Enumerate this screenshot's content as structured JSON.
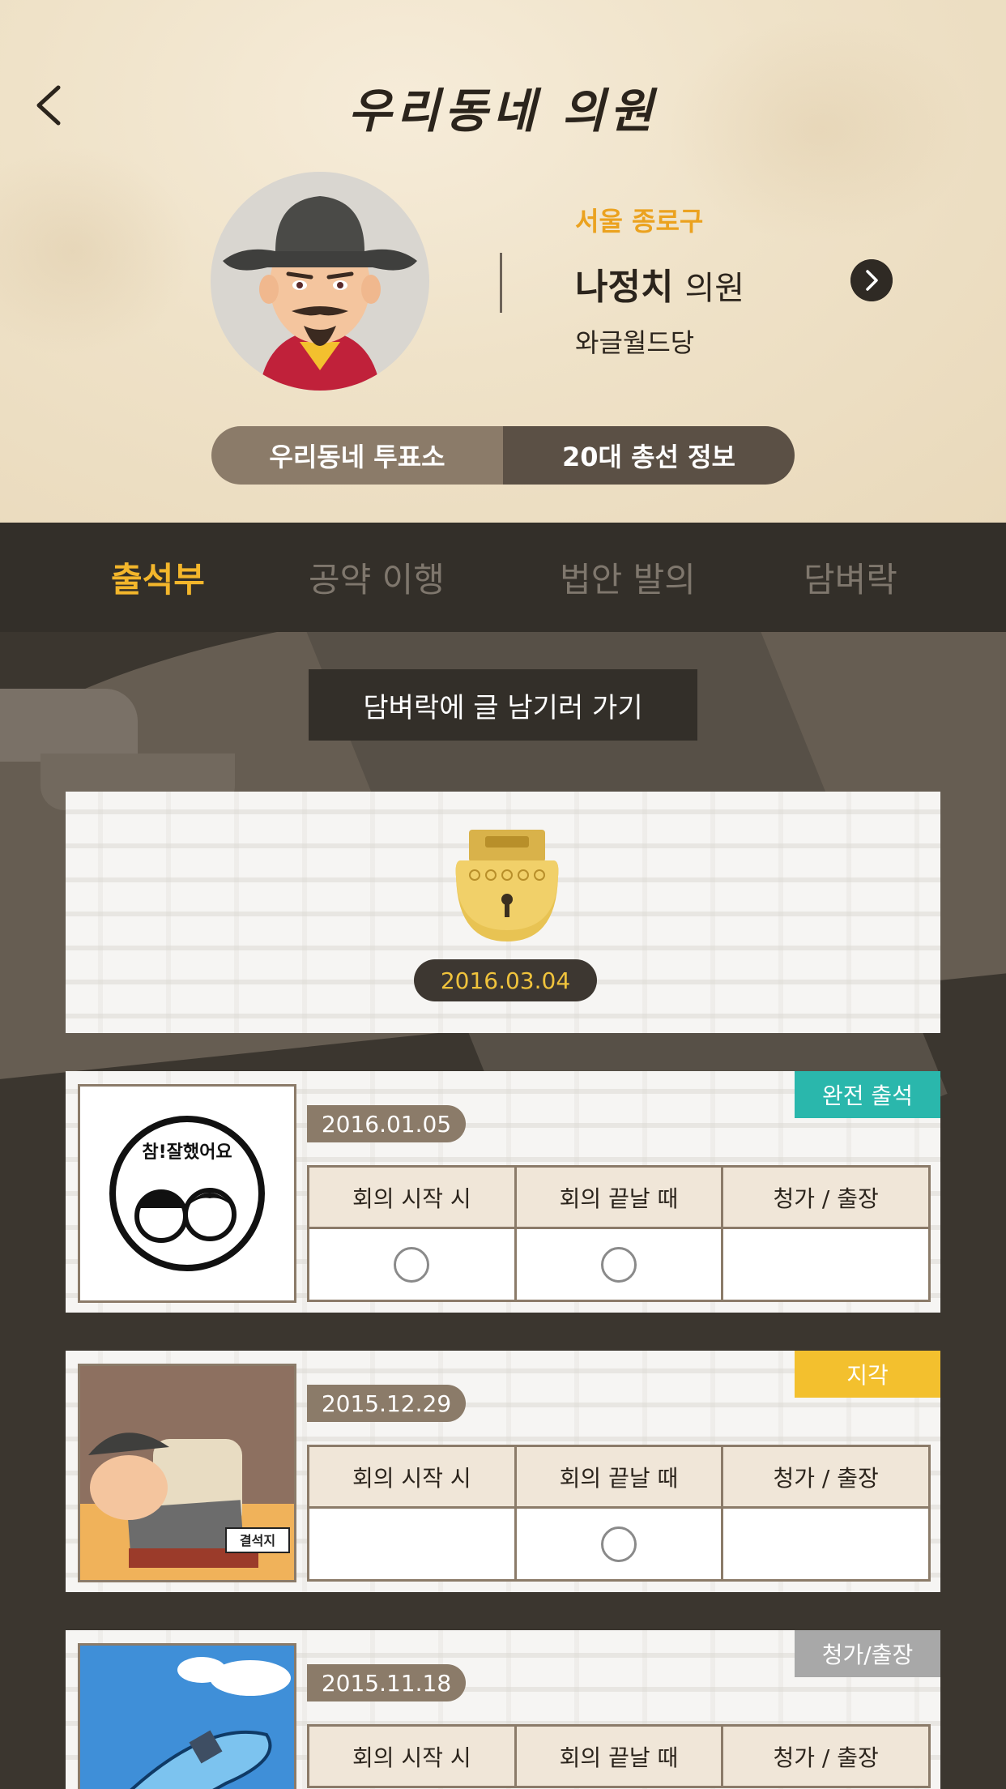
{
  "header": {
    "title": "우리동네 의원",
    "district": "서울 종로구",
    "name": "나정치",
    "role": "의원",
    "party": "와글월드당",
    "buttons": {
      "left": "우리동네 투표소",
      "right": "20대 총선 정보"
    }
  },
  "tabs": [
    {
      "label": "출석부",
      "active": true
    },
    {
      "label": "공약 이행",
      "active": false
    },
    {
      "label": "법안 발의",
      "active": false
    },
    {
      "label": "담벼락",
      "active": false
    }
  ],
  "write_button": "담벼락에 글 남기러 가기",
  "lock_card": {
    "date": "2016.03.04"
  },
  "table_headers": [
    "회의 시작 시",
    "회의 끝날 때",
    "청가 / 출장"
  ],
  "records": [
    {
      "date": "2016.01.05",
      "badge": "완전 출석",
      "badge_color": "#2ab7ac",
      "thumb_text": "참!잘했어요",
      "marks": [
        true,
        true,
        false
      ]
    },
    {
      "date": "2015.12.29",
      "badge": "지각",
      "badge_color": "#f3c02e",
      "thumb_text": "결석지",
      "marks": [
        false,
        true,
        false
      ]
    },
    {
      "date": "2015.11.18",
      "badge": "청가/출장",
      "badge_color": "#a8a8a8",
      "marks": []
    }
  ],
  "colors": {
    "accent": "#f3b62b",
    "tab_bar": "#332f29",
    "brown": "#8b7b69",
    "dark_brown": "#5b5045"
  }
}
